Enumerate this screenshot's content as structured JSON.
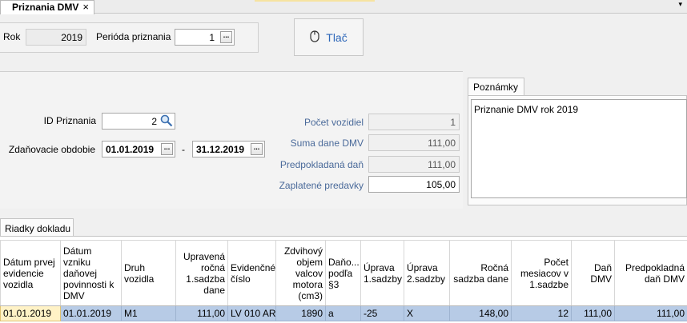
{
  "tab": {
    "title": "Priznania DMV",
    "close_glyph": "×",
    "dropdown_glyph": "▾"
  },
  "top": {
    "rok_label": "Rok",
    "rok_value": "2019",
    "perioda_label": "Perióda priznania",
    "perioda_value": "1",
    "ellipsis": "...",
    "print_label": "Tlač",
    "print_icon": "mouse-icon"
  },
  "form": {
    "id_label": "ID Priznania",
    "id_value": "2",
    "obdobie_label": "Zdaňovacie obdobie",
    "obdobie_from": "01.01.2019",
    "obdobie_sep": "-",
    "obdobie_to": "31.12.2019",
    "pocet_label": "Počet vozidiel",
    "pocet_value": "1",
    "suma_label": "Suma dane DMV",
    "suma_value": "111,00",
    "predpokladana_label": "Predpokladaná daň",
    "predpokladana_value": "111,00",
    "zaplatene_label": "Zaplatené predavky",
    "zaplatene_value": "105,00"
  },
  "notes": {
    "tab_label": "Poznámky",
    "text": "Priznanie DMV rok 2019"
  },
  "section_tab": "Riadky dokladu",
  "grid": {
    "columns": [
      "Dátum prvej evidencie vozidla",
      "Dátum vzniku daňovej povinnosti k DMV",
      "Druh vozidla",
      "Upravená ročná 1.sadzba dane",
      "Evidenčné číslo",
      "Zdvihový objem valcov motora (cm3)",
      "Daňo... podľa §3",
      "Úprava 1.sadzby",
      "Úprava 2.sadzby",
      "Ročná sadzba dane",
      "Počet mesiacov v 1.sadzbe",
      "Daň DMV",
      "Predpokladná daň DMV"
    ],
    "rows": [
      [
        "01.01.2019",
        "01.01.2019",
        "M1",
        "111,00",
        "LV 010 AR",
        "1890",
        "a",
        "-25",
        "X",
        "148,00",
        "12",
        "111,00",
        "111,00"
      ]
    ]
  }
}
